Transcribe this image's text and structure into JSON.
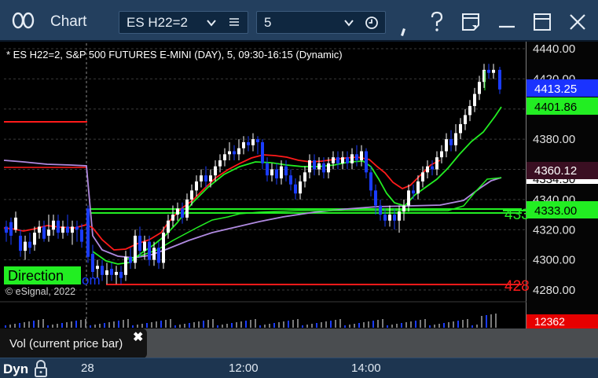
{
  "window": {
    "app_icon": "two-rings-icon",
    "title": "Chart",
    "symbol_value": "ES H22=2",
    "interval_value": "5",
    "icons": [
      "chevron-down-icon",
      "list-icon",
      "chevron-down-icon",
      "clock-icon",
      "pencil-icon",
      "help-icon",
      "page-icon",
      "minimize-icon",
      "maximize-icon",
      "close-icon"
    ]
  },
  "chart": {
    "header": "* ES H22=2, S&P 500 FUTURES E-MINI (DAY), 5, 09:30-16:15 (Dynamic)",
    "copyright": "© eSignal, 2022",
    "direction_label": "Direction",
    "partial_overlay_text": "om",
    "right_edge_label_1": "433",
    "right_edge_label_2": "428",
    "price_axis_ticks": [
      "4440.00",
      "4420.00",
      "4400.00",
      "4380.00",
      "4360.00",
      "4340.00",
      "4320.00",
      "4300.00",
      "4280.00"
    ],
    "price_labels": [
      {
        "value": "4413.25",
        "bg": "#1a33ff",
        "fg": "#ffffff"
      },
      {
        "value": "4401.86",
        "bg": "#22ee22",
        "fg": "#000000"
      },
      {
        "value": "4360.12",
        "bg": "#3a0f22",
        "fg": "#ffffff"
      },
      {
        "value": "4334.50",
        "bg": "#ffffff",
        "fg": "#000000"
      },
      {
        "value": "4333.00",
        "bg": "#22ee22",
        "fg": "#000000"
      }
    ],
    "volume_label": "12362",
    "volume_label_bg": "#e60000",
    "vol_panel_title": "Vol (current price bar)",
    "vol_close_icon": "close-icon"
  },
  "bottom_bar": {
    "dyn_label": "Dyn",
    "lock_icon": "lock-icon",
    "time_labels": [
      "28",
      "12:00",
      "14:00"
    ]
  },
  "colors": {
    "titlebar": "#233f5e",
    "candle_up": "#ffffff",
    "candle_down": "#1a3cff",
    "ma_red": "#ff1a1a",
    "ma_green": "#22ee22",
    "ma_purple": "#b08ae0"
  }
}
